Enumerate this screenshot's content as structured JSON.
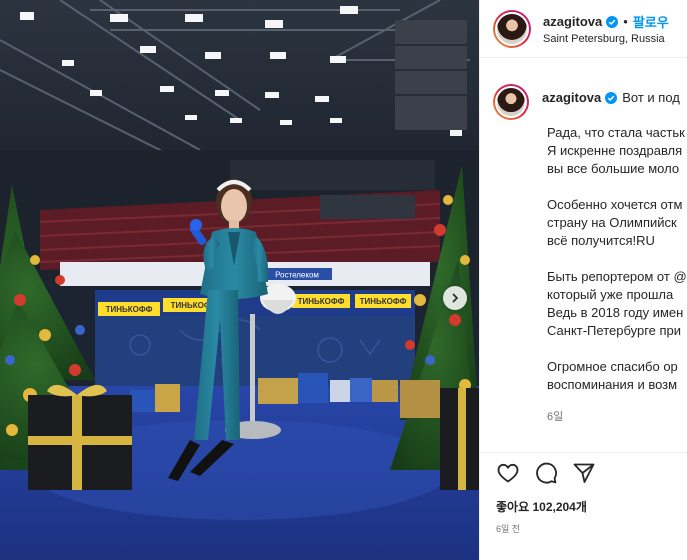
{
  "post": {
    "username": "azagitova",
    "follow_label": "팔로우",
    "location": "Saint Petersburg, Russia",
    "caption_username": "azagitova",
    "caption_first_line": "Вот и под",
    "caption_paragraphs": [
      [
        "Рада, что стала частьк",
        "Я искренне поздравля",
        "вы все большие моло"
      ],
      [
        "Особенно хочется отм",
        "страну на Олимпийск",
        "всё получится!RU"
      ],
      [
        "Быть репортером от @",
        "который уже прошла",
        "Ведь в 2018 году имен",
        "Санкт-Петербурге при"
      ],
      [
        "Огромное спасибо ор",
        "воспоминания и возм"
      ]
    ],
    "caption_time": "6일",
    "likes_label": "좋아요",
    "likes_count": "102,204개",
    "posted_ago": "6일 전"
  },
  "photo": {
    "banner_brand": "ТИНЬКОФФ",
    "board_brand": "Ростелеком"
  },
  "icons": {
    "verified": "verified-badge-icon",
    "like": "heart-icon",
    "comment": "comment-icon",
    "share": "share-icon",
    "next": "chevron-right-icon"
  },
  "colors": {
    "link": "#0095f6",
    "verified": "#0095f6",
    "text": "#262626",
    "muted": "#737373"
  }
}
